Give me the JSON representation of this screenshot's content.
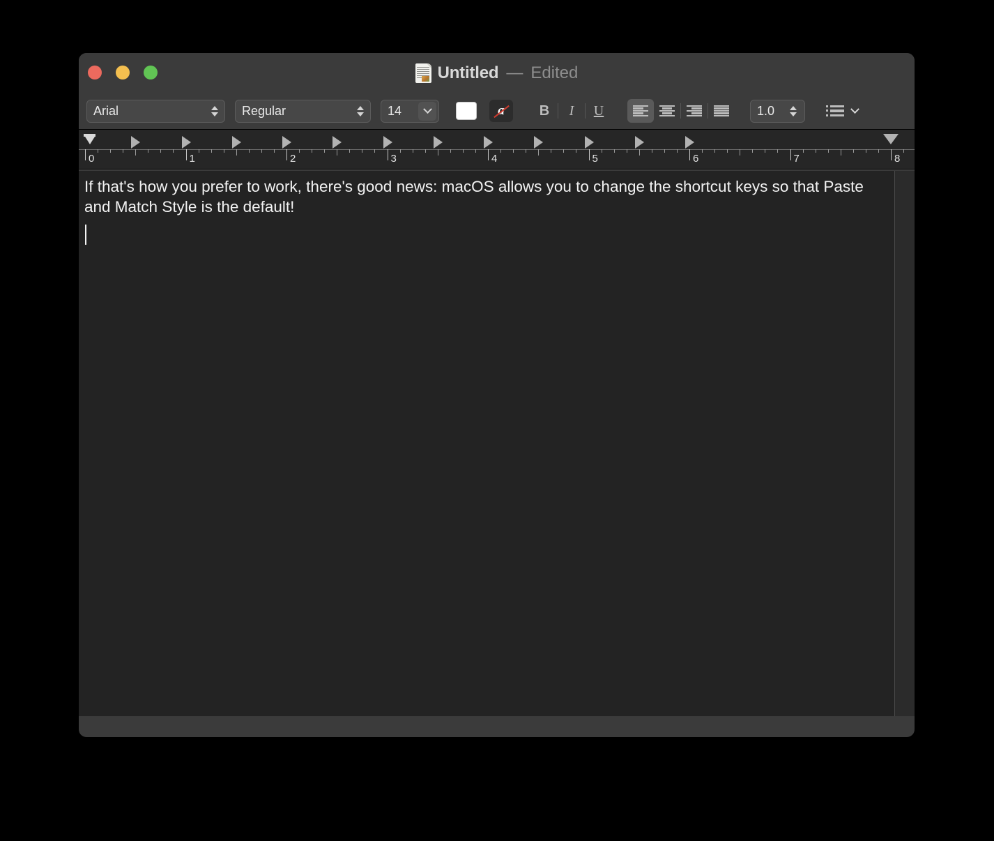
{
  "window": {
    "title": "Untitled",
    "dash": "—",
    "status": "Edited",
    "doc_icon": "document-icon",
    "traffic_lights": [
      {
        "name": "close",
        "color": "#ec6a5e"
      },
      {
        "name": "minimize",
        "color": "#f4bf4f"
      },
      {
        "name": "maximize",
        "color": "#61c554"
      }
    ]
  },
  "toolbar": {
    "font_family": "Arial",
    "font_style": "Regular",
    "font_size": "14",
    "line_spacing": "1.0",
    "color_swatch": "#ffffff",
    "text_color_glyph": "a",
    "bold_label": "B",
    "italic_label": "I",
    "underline_label": "U",
    "align_active": "left",
    "alignments": [
      "align-left",
      "align-center",
      "align-right",
      "align-justify"
    ],
    "list_label": "lists"
  },
  "ruler": {
    "unit_labels": [
      "0",
      "1",
      "2",
      "3",
      "4",
      "5",
      "6",
      "7",
      "8"
    ],
    "left_indent_position": "0",
    "right_indent_position": "8",
    "tab_stops": [
      "0.5",
      "1",
      "1.5",
      "2",
      "2.5",
      "3",
      "3.5",
      "4",
      "4.5",
      "5",
      "5.5",
      "6"
    ]
  },
  "document": {
    "body_text": "If that's how you prefer to work, there's good news: macOS allows you to change the shortcut keys so that Paste and Match Style is the default!",
    "caret_line": 3
  }
}
